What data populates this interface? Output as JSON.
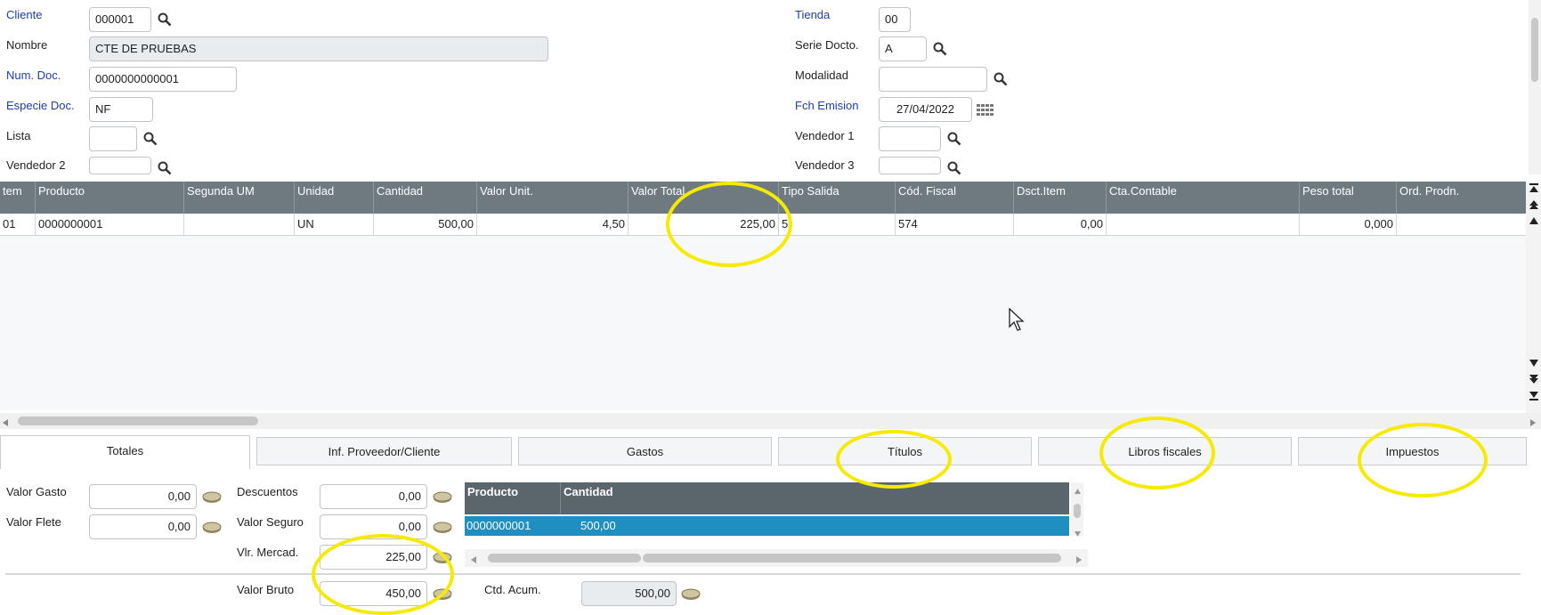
{
  "header": {
    "cliente": {
      "label": "Cliente",
      "value": "000001"
    },
    "nombre": {
      "label": "Nombre",
      "value": "CTE DE PRUEBAS"
    },
    "num_doc": {
      "label": "Num. Doc.",
      "value": "0000000000001"
    },
    "especie_doc": {
      "label": "Especie Doc.",
      "value": "NF"
    },
    "lista": {
      "label": "Lista",
      "value": ""
    },
    "vendedor2": {
      "label": "Vendedor 2",
      "value": ""
    },
    "tienda": {
      "label": "Tienda",
      "value": "00"
    },
    "serie_docto": {
      "label": "Serie Docto.",
      "value": "A"
    },
    "modalidad": {
      "label": "Modalidad",
      "value": ""
    },
    "fch_emision": {
      "label": "Fch Emision",
      "value": "27/04/2022"
    },
    "vendedor1": {
      "label": "Vendedor 1",
      "value": ""
    },
    "vendedor3": {
      "label": "Vendedor 3",
      "value": ""
    }
  },
  "items_grid": {
    "columns": [
      "tem",
      "Producto",
      "Segunda UM",
      "Unidad",
      "Cantidad",
      "Valor Unit.",
      "Valor Total",
      "Tipo Salida",
      "Cód. Fiscal",
      "Dsct.Item",
      "Cta.Contable",
      "Peso total",
      "Ord. Prodn."
    ],
    "rows": [
      {
        "item": "01",
        "producto": "0000000001",
        "segunda_um": "",
        "unidad": "UN",
        "cantidad": "500,00",
        "valor_unit": "4,50",
        "valor_total": "225,00",
        "tipo_salida": "5",
        "cod_fiscal": "574",
        "dsct_item": "0,00",
        "cta_contable": "",
        "peso_total": "0,000",
        "ord_prodn": ""
      }
    ]
  },
  "tabs": [
    {
      "label": "Totales",
      "active": true
    },
    {
      "label": "Inf. Proveedor/Cliente"
    },
    {
      "label": "Gastos"
    },
    {
      "label": "Títulos"
    },
    {
      "label": "Libros fiscales"
    },
    {
      "label": "Impuestos"
    }
  ],
  "totals": {
    "valor_gasto": {
      "label": "Valor Gasto",
      "value": "0,00"
    },
    "valor_flete": {
      "label": "Valor Flete",
      "value": "0,00"
    },
    "descuentos": {
      "label": "Descuentos",
      "value": "0,00"
    },
    "valor_seguro": {
      "label": "Valor Seguro",
      "value": "0,00"
    },
    "vlr_mercad": {
      "label": "Vlr. Mercad.",
      "value": "225,00"
    },
    "valor_bruto": {
      "label": "Valor Bruto",
      "value": "450,00"
    },
    "ctd_acum": {
      "label": "Ctd. Acum.",
      "value": "500,00"
    }
  },
  "subgrid": {
    "columns": [
      "Producto",
      "Cantidad"
    ],
    "rows": [
      {
        "producto": "0000000001",
        "cantidad": "500,00"
      }
    ]
  },
  "colors": {
    "grid_header": "#6f7a80",
    "selected_row": "#1e8fc0",
    "highlight": "#f5ea00",
    "label_blue": "#1f3fa6"
  },
  "icons": [
    "search-icon",
    "calendar-icon",
    "money-icon",
    "mouse-cursor-icon"
  ]
}
